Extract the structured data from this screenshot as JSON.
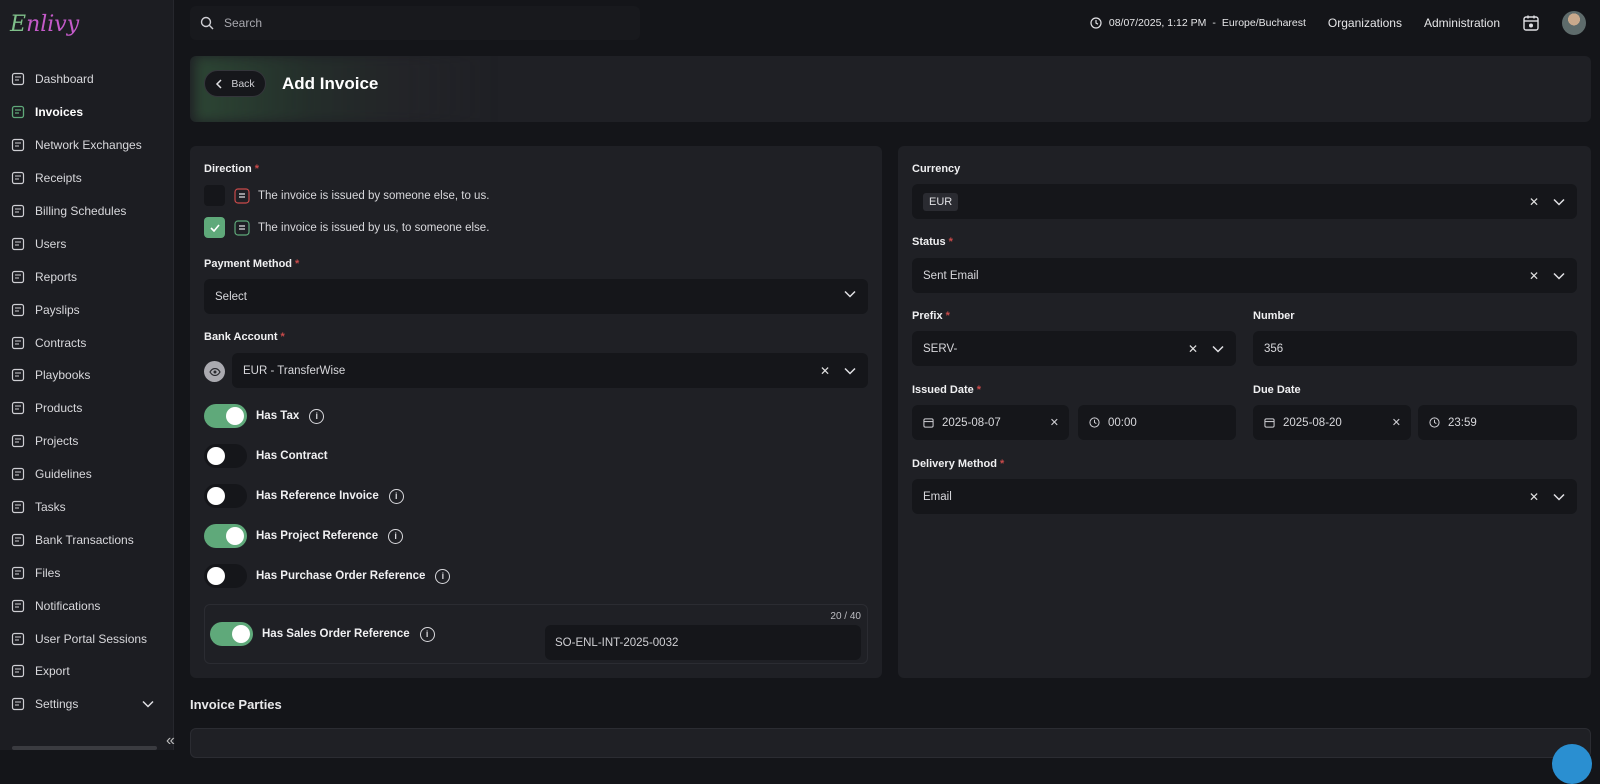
{
  "app": {
    "logo": "Enlivy"
  },
  "sidebar": {
    "items": [
      {
        "label": "Dashboard",
        "icon": "dashboard-icon"
      },
      {
        "label": "Invoices",
        "icon": "invoice-icon",
        "active": true
      },
      {
        "label": "Network Exchanges",
        "icon": "exchange-icon"
      },
      {
        "label": "Receipts",
        "icon": "receipt-icon"
      },
      {
        "label": "Billing Schedules",
        "icon": "billing-icon"
      },
      {
        "label": "Users",
        "icon": "users-icon"
      },
      {
        "label": "Reports",
        "icon": "reports-icon"
      },
      {
        "label": "Payslips",
        "icon": "payslip-icon"
      },
      {
        "label": "Contracts",
        "icon": "contract-icon"
      },
      {
        "label": "Playbooks",
        "icon": "playbook-icon"
      },
      {
        "label": "Products",
        "icon": "product-icon"
      },
      {
        "label": "Projects",
        "icon": "project-icon"
      },
      {
        "label": "Guidelines",
        "icon": "guidelines-icon"
      },
      {
        "label": "Tasks",
        "icon": "tasks-icon"
      },
      {
        "label": "Bank Transactions",
        "icon": "bank-icon"
      },
      {
        "label": "Files",
        "icon": "file-icon"
      },
      {
        "label": "Notifications",
        "icon": "notification-icon"
      },
      {
        "label": "User Portal Sessions",
        "icon": "portal-icon"
      },
      {
        "label": "Export",
        "icon": "export-icon"
      },
      {
        "label": "Settings",
        "icon": "settings-icon",
        "expandable": true
      }
    ]
  },
  "topbar": {
    "search_placeholder": "Search",
    "datetime": "08/07/2025, 1:12 PM",
    "timezone": "Europe/Bucharest",
    "organizations": "Organizations",
    "administration": "Administration"
  },
  "header": {
    "back_label": "Back",
    "title": "Add Invoice"
  },
  "form_left": {
    "direction_label": "Direction",
    "direction_options": [
      {
        "label": "The invoice is issued by someone else, to us.",
        "checked": false
      },
      {
        "label": "The invoice is issued by us, to someone else.",
        "checked": true
      }
    ],
    "payment_method_label": "Payment Method",
    "payment_method_value": "Select",
    "bank_account_label": "Bank Account",
    "bank_account_value": "EUR - TransferWise",
    "toggles": [
      {
        "label": "Has Tax",
        "on": true,
        "info": true
      },
      {
        "label": "Has Contract",
        "on": false,
        "info": false
      },
      {
        "label": "Has Reference Invoice",
        "on": false,
        "info": true
      },
      {
        "label": "Has Project Reference",
        "on": true,
        "info": true
      },
      {
        "label": "Has Purchase Order Reference",
        "on": false,
        "info": true
      }
    ],
    "sales_order": {
      "label": "Has Sales Order Reference",
      "on": true,
      "counter": "20 / 40",
      "value": "SO-ENL-INT-2025-0032"
    }
  },
  "form_right": {
    "currency_label": "Currency",
    "currency_value": "EUR",
    "status_label": "Status",
    "status_value": "Sent Email",
    "prefix_label": "Prefix",
    "prefix_value": "SERV-",
    "number_label": "Number",
    "number_value": "356",
    "issued_date_label": "Issued Date",
    "issued_date_value": "2025-08-07",
    "issued_time_value": "00:00",
    "due_date_label": "Due Date",
    "due_date_value": "2025-08-20",
    "due_time_value": "23:59",
    "delivery_method_label": "Delivery Method",
    "delivery_method_value": "Email"
  },
  "sections": {
    "invoice_parties": "Invoice Parties"
  },
  "colors": {
    "accent_green": "#5fa97a",
    "required_red": "#c94a4a",
    "background": "#141519",
    "card": "#1f2025"
  }
}
